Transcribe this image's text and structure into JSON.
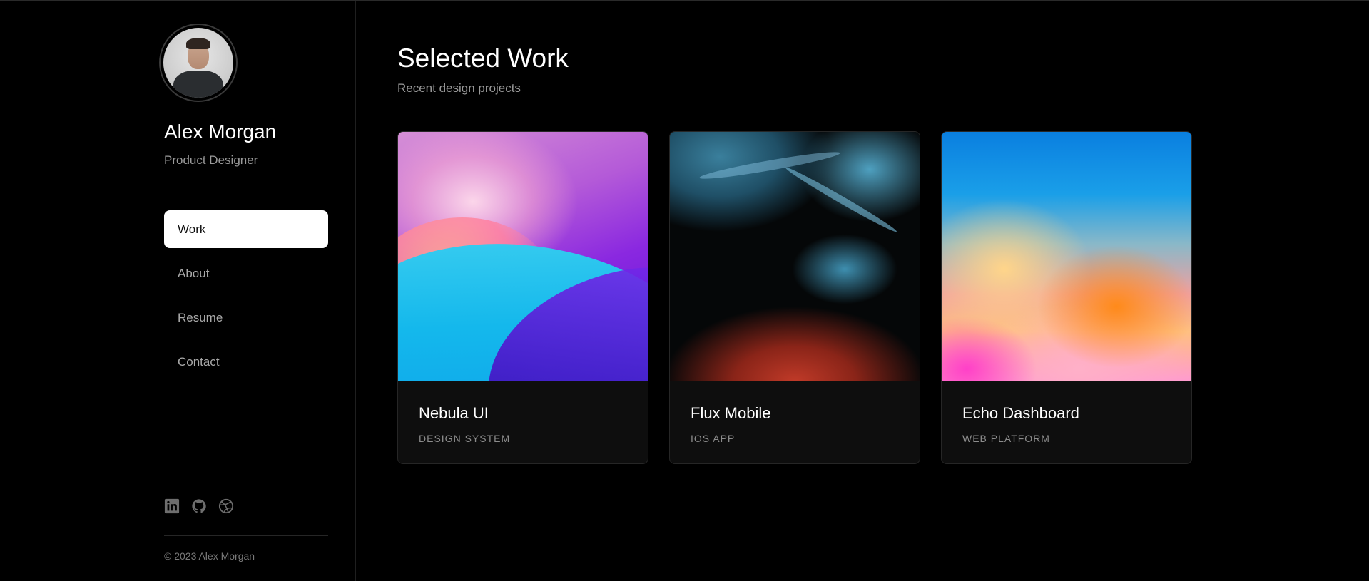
{
  "profile": {
    "name": "Alex Morgan",
    "role": "Product Designer"
  },
  "nav": {
    "items": [
      {
        "label": "Work",
        "active": true
      },
      {
        "label": "About",
        "active": false
      },
      {
        "label": "Resume",
        "active": false
      },
      {
        "label": "Contact",
        "active": false
      }
    ]
  },
  "socials": [
    "linkedin-icon",
    "github-icon",
    "dribbble-icon"
  ],
  "footer": {
    "copyright": "© 2023 Alex Morgan"
  },
  "main": {
    "title": "Selected Work",
    "subtitle": "Recent design projects",
    "cards": [
      {
        "title": "Nebula UI",
        "tag": "DESIGN SYSTEM"
      },
      {
        "title": "Flux Mobile",
        "tag": "IOS APP"
      },
      {
        "title": "Echo Dashboard",
        "tag": "WEB PLATFORM"
      }
    ]
  },
  "colors": {
    "background": "#000000",
    "active_nav_bg": "#ffffff",
    "muted_text": "#9a9a9a",
    "card_bg": "#0e0e0e"
  }
}
